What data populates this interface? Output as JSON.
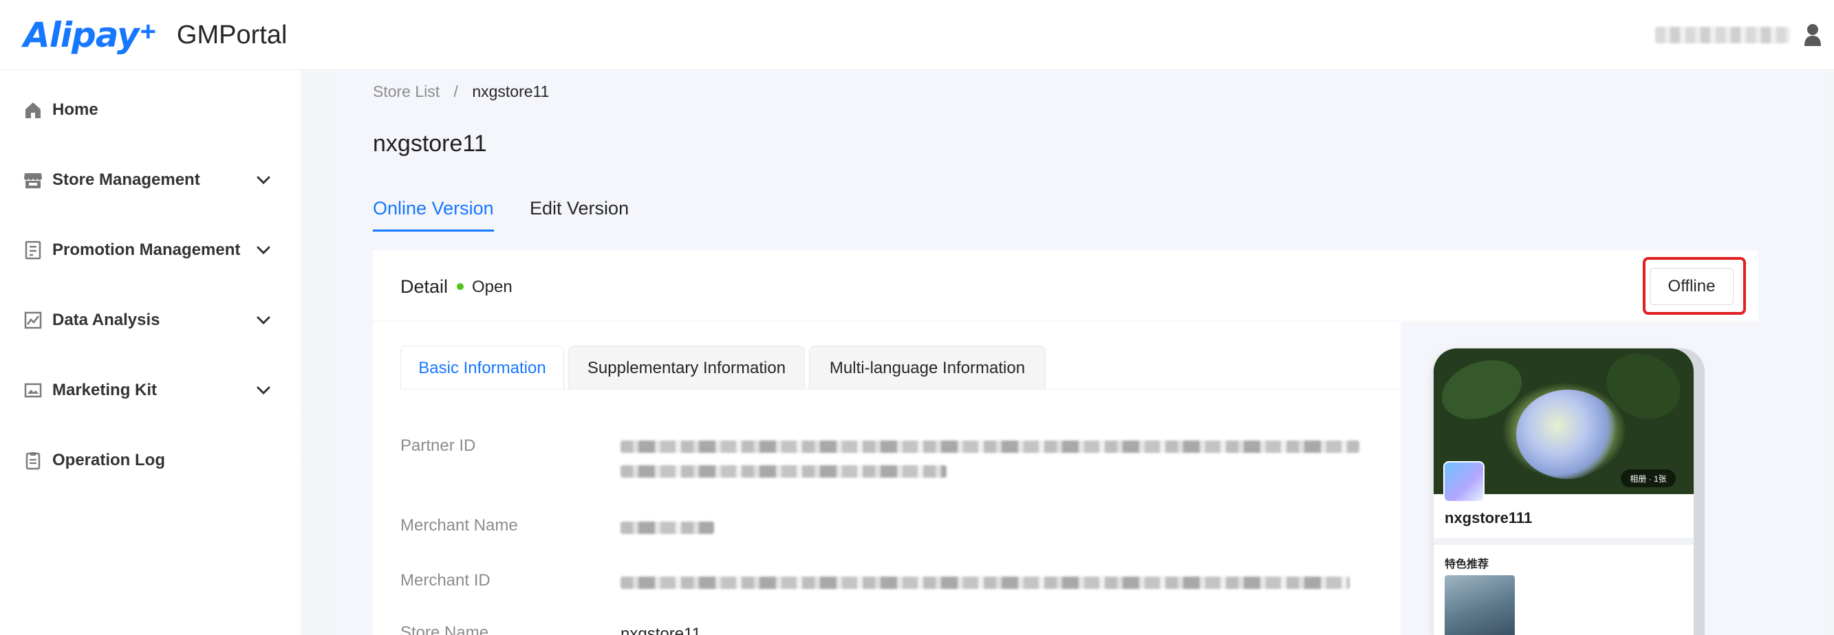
{
  "header": {
    "brand": "Alipay",
    "brand_plus": "+",
    "portal": "GMPortal"
  },
  "sidebar": {
    "items": [
      {
        "label": "Home",
        "icon": "home-icon"
      },
      {
        "label": "Store Management",
        "icon": "store-icon"
      },
      {
        "label": "Promotion Management",
        "icon": "receipt-icon"
      },
      {
        "label": "Data Analysis",
        "icon": "chart-icon"
      },
      {
        "label": "Marketing Kit",
        "icon": "image-icon"
      },
      {
        "label": "Operation Log",
        "icon": "clipboard-icon"
      }
    ]
  },
  "breadcrumb": {
    "parent": "Store List",
    "separator": "/",
    "current": "nxgstore11"
  },
  "page": {
    "title": "nxgstore11"
  },
  "version_tabs": {
    "online": "Online Version",
    "edit": "Edit Version",
    "active": "online"
  },
  "detail": {
    "title": "Detail",
    "status": "Open",
    "status_color": "#52c41a",
    "offline_button": "Offline"
  },
  "info_tabs": {
    "basic": "Basic Information",
    "supplementary": "Supplementary Information",
    "multilanguage": "Multi-language Information",
    "active": "basic"
  },
  "fields": {
    "partner_id_label": "Partner ID",
    "merchant_name_label": "Merchant Name",
    "merchant_id_label": "Merchant ID",
    "store_name_label": "Store Name",
    "store_name_value": "nxgstore11"
  },
  "preview": {
    "store_name": "nxgstore111",
    "photo_badge": "相册 · 1张",
    "section_title": "特色推荐"
  },
  "colors": {
    "accent": "#1677ff",
    "highlight_border": "#e02020"
  }
}
